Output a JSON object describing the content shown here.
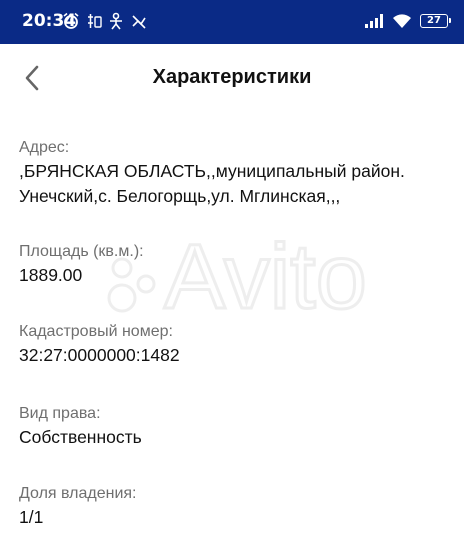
{
  "status_bar": {
    "time": "20:34",
    "battery": "27",
    "icons_left": [
      "alarm-icon",
      "sim-card-icon",
      "accessibility-icon",
      "no-signal-icon"
    ],
    "icons_right": [
      "signal-icon",
      "wifi-icon",
      "battery-icon"
    ]
  },
  "header": {
    "title": "Характеристики",
    "back_icon": "chevron-left-icon"
  },
  "fields": {
    "address": {
      "label": "Адрес:",
      "value_line1": ",БРЯНСКАЯ ОБЛАСТЬ,,муниципальный район.",
      "value_line2": "Унечский,с. Белогорщь,ул. Мглинская,,,"
    },
    "area": {
      "label": "Площадь (кв.м.):",
      "value": "1889.00"
    },
    "cadastral": {
      "label": "Кадастровый номер:",
      "value": "32:27:0000000:1482"
    },
    "right_type": {
      "label": "Вид права:",
      "value": "Собственность"
    },
    "share": {
      "label": "Доля владения:",
      "value": "1/1"
    }
  },
  "watermark": {
    "text": "Avito"
  },
  "colors": {
    "status_bar_bg": "#0a2a86",
    "label": "#6f6f6f",
    "value": "#111111"
  }
}
